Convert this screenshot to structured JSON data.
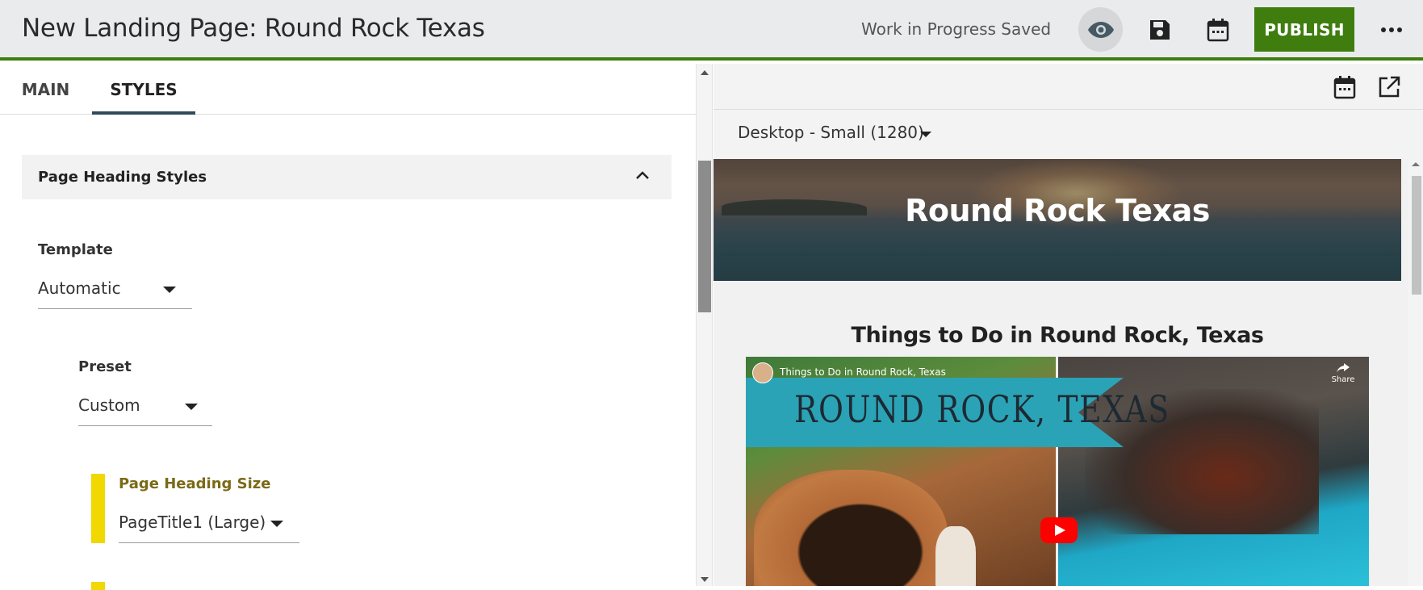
{
  "header": {
    "title": "New Landing Page: Round Rock Texas",
    "status": "Work in Progress Saved",
    "publish_label": "PUBLISH",
    "icons": [
      "eye-icon",
      "save-icon",
      "calendar-icon",
      "more-icon"
    ],
    "accent_color": "#3e7d0e"
  },
  "tabs": [
    {
      "label": "MAIN",
      "selected": false
    },
    {
      "label": "STYLES",
      "selected": true
    }
  ],
  "styles_panel": {
    "section_title": "Page Heading Styles",
    "template": {
      "label": "Template",
      "value": "Automatic"
    },
    "preset": {
      "label": "Preset",
      "value": "Custom"
    },
    "heading_size": {
      "label": "Page Heading Size",
      "value": "PageTitle1 (Large)"
    }
  },
  "preview": {
    "device": "Desktop - Small (1280)",
    "hero_title": "Round Rock Texas",
    "section_heading": "Things to Do in Round Rock, Texas",
    "video": {
      "title": "Things to Do in Round Rock, Texas",
      "banner_text": "ROUND ROCK, TEXAS",
      "share_label": "Share"
    },
    "icons": [
      "calendar-icon",
      "open-external-icon"
    ]
  }
}
